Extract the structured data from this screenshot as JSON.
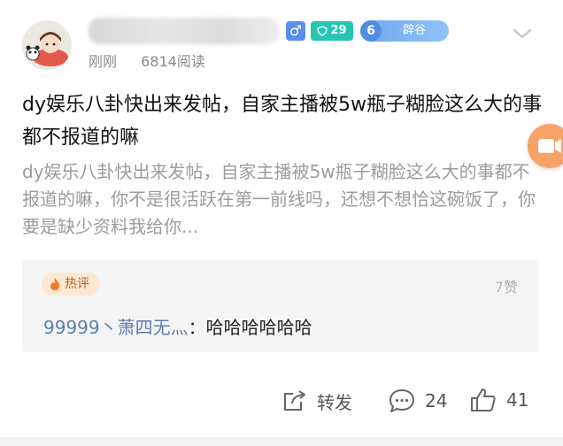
{
  "post": {
    "time": "刚刚",
    "views": "6814阅读",
    "gender_symbol": "♂",
    "level": "29",
    "badge_number": "6",
    "badge_text": "辟谷",
    "title": "dy娱乐八卦快出来发帖，自家主播被5w瓶子糊脸这么大的事都不报道的嘛",
    "excerpt": "dy娱乐八卦快出来发帖，自家主播被5w瓶子糊脸这么大的事都不报道的嘛，你不是很活跃在第一前线吗，还想不想恰这碗饭了，你要是缺少资料我给你..."
  },
  "hot_comment": {
    "tag": "热评",
    "likes": "7赞",
    "user": "99999丶萧四无灬",
    "separator": "：",
    "text": "哈哈哈哈哈哈"
  },
  "actions": {
    "share_label": "转发",
    "comments_count": "24",
    "likes_count": "41"
  },
  "colors": {
    "accent_blue": "#5b8ef0",
    "level_teal": "#26c6b4",
    "video_orange": "#f7a266"
  }
}
